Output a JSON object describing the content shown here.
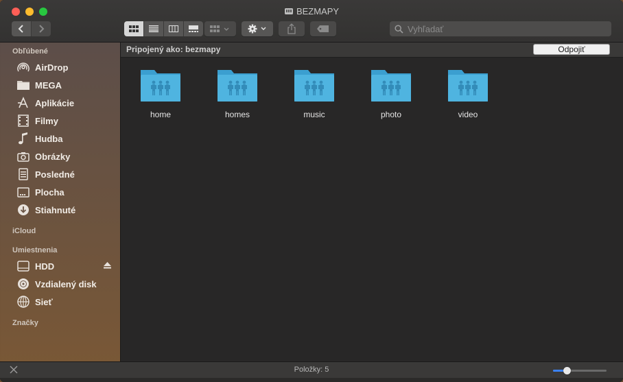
{
  "window": {
    "title": "BEZMAPY"
  },
  "toolbar": {
    "search_placeholder": "Vyhľadať",
    "view_modes": [
      "icons-view",
      "list-view",
      "columns-view",
      "gallery-view"
    ],
    "active_view": "icons-view"
  },
  "sidebar": {
    "favorites_header": "Obľúbené",
    "favorites": [
      {
        "label": "AirDrop",
        "icon": "airdrop-icon"
      },
      {
        "label": "MEGA",
        "icon": "folder-icon"
      },
      {
        "label": "Aplikácie",
        "icon": "applications-icon"
      },
      {
        "label": "Filmy",
        "icon": "movies-icon"
      },
      {
        "label": "Hudba",
        "icon": "music-icon"
      },
      {
        "label": "Obrázky",
        "icon": "camera-icon"
      },
      {
        "label": "Posledné",
        "icon": "recents-icon"
      },
      {
        "label": "Plocha",
        "icon": "desktop-icon"
      },
      {
        "label": "Stiahnuté",
        "icon": "downloads-icon"
      }
    ],
    "icloud_header": "iCloud",
    "locations_header": "Umiestnenia",
    "locations": [
      {
        "label": "HDD",
        "icon": "hard-drive-icon"
      },
      {
        "label": "Vzdialený disk",
        "icon": "remote-disc-icon"
      },
      {
        "label": "Sieť",
        "icon": "network-icon"
      }
    ],
    "tags_header": "Značky"
  },
  "main": {
    "connected_as": "Pripojený ako: bezmapy",
    "disconnect_label": "Odpojiť",
    "folders": [
      {
        "label": "home"
      },
      {
        "label": "homes"
      },
      {
        "label": "music"
      },
      {
        "label": "photo"
      },
      {
        "label": "video"
      }
    ]
  },
  "status": {
    "items_count": "Položky: 5",
    "icon_size": 0.25
  },
  "colors": {
    "folder_top": "#3b9fd0",
    "folder_body": "#4fb4e0",
    "accent": "#3b82f6"
  }
}
